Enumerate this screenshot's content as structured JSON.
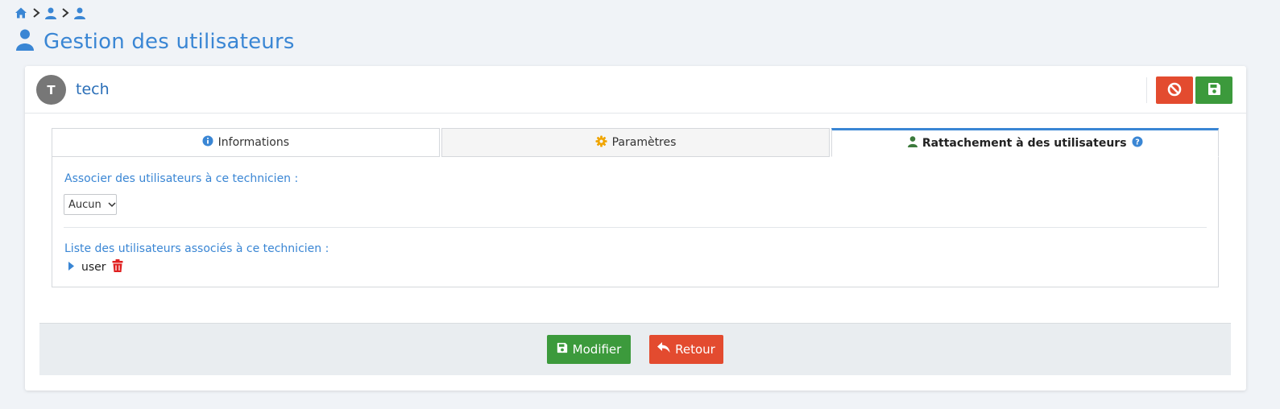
{
  "colors": {
    "accent": "#3a86d4",
    "success": "#3c9a3c",
    "danger": "#e34b2f",
    "warning_icon": "#f0a500",
    "user_icon_green": "#3c7a3c",
    "trash_red": "#e02020"
  },
  "breadcrumb": {
    "items": [
      {
        "icon": "home-icon"
      },
      {
        "icon": "user-icon"
      },
      {
        "icon": "user-icon"
      }
    ]
  },
  "page": {
    "title": "Gestion des utilisateurs",
    "title_icon": "user-icon"
  },
  "record": {
    "avatar_letter": "T",
    "name": "tech"
  },
  "toolbar": {
    "cancel_icon": "ban-icon",
    "save_icon": "floppy-disk-icon"
  },
  "tabs": [
    {
      "label": "Informations",
      "icon": "info-circle-icon",
      "active": false
    },
    {
      "label": "Paramètres",
      "icon": "gear-icon",
      "active": false
    },
    {
      "label": "Rattachement à des utilisateurs",
      "icon": "user-icon",
      "help_icon": "question-circle-icon",
      "active": true
    }
  ],
  "panel": {
    "associate_label": "Associer des utilisateurs à ce technicien :",
    "select_value": "Aucun",
    "list_label": "Liste des utilisateurs associés à ce technicien :",
    "users": [
      {
        "name": "user"
      }
    ]
  },
  "footer": {
    "modify_label": "Modifier",
    "back_label": "Retour"
  }
}
